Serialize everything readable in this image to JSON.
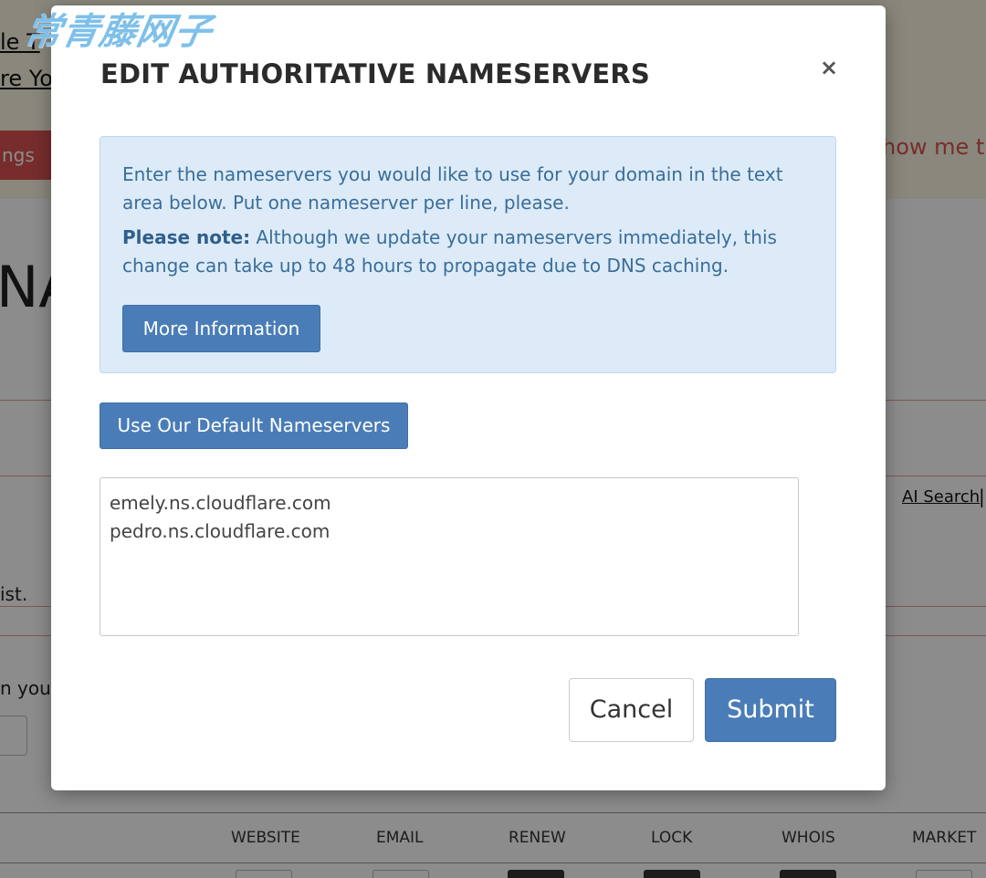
{
  "watermark": "常青藤网子",
  "background": {
    "link_1": "le T",
    "link_2": "re Yo",
    "red_button": "ngs",
    "show_me": "how me th",
    "heading_partial": "NA",
    "ai_search": "AI Search",
    "pipe": "|",
    "text_ist": "ist.",
    "text_your": "n your",
    "table_headers": [
      "WEBSITE",
      "EMAIL",
      "RENEW",
      "LOCK",
      "WHOIS",
      "MARKET"
    ]
  },
  "modal": {
    "title": "EDIT AUTHORITATIVE NAMESERVERS",
    "close_icon": "×",
    "info": {
      "text": "Enter the nameservers you would like to use for your domain in the text area below. Put one nameserver per line, please.",
      "note_label": "Please note:",
      "note_text": " Although we update your nameservers immediately, this change can take up to 48 hours to propagate due to DNS caching.",
      "more_info_button": "More Information"
    },
    "default_ns_button": "Use Our Default Nameservers",
    "nameservers": [
      "emely.ns.cloudflare.com",
      "pedro.ns.cloudflare.com"
    ],
    "cancel_button": "Cancel",
    "submit_button": "Submit"
  },
  "colors": {
    "primary_button": "#4a7db7",
    "info_bg": "#dcebf7",
    "info_text": "#3a6d9a",
    "danger": "#d9534f"
  }
}
